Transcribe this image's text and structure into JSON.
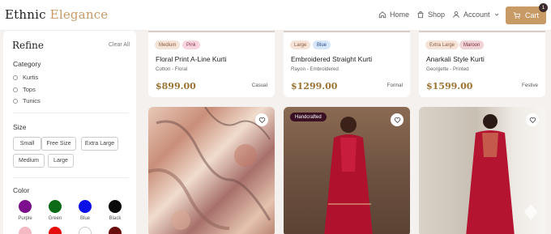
{
  "header": {
    "brand_part1": "Ethnic",
    "brand_part2": "Elegance",
    "nav_home": "Home",
    "nav_shop": "Shop",
    "nav_account": "Account",
    "cart_label": "Cart",
    "cart_count": "1",
    "accent_color": "#c89a66"
  },
  "sidebar": {
    "title": "Refine",
    "clear_all": "Clear All",
    "category_title": "Category",
    "categories": [
      "Kurtis",
      "Tops",
      "Tunics"
    ],
    "size_title": "Size",
    "sizes": [
      "Small",
      "Free Size",
      "Extra Large",
      "Medium",
      "Large"
    ],
    "color_title": "Color",
    "colors": [
      {
        "name": "Purple",
        "hex": "#7b0f8c"
      },
      {
        "name": "Green",
        "hex": "#0b6b16"
      },
      {
        "name": "Blue",
        "hex": "#0a10e6"
      },
      {
        "name": "Black",
        "hex": "#0a0a0a"
      }
    ],
    "colors_row2": [
      {
        "hex": "#f4b9c3"
      },
      {
        "hex": "#e60d0d"
      },
      {
        "hex": "#ffffff"
      },
      {
        "hex": "#6a0d0d"
      }
    ]
  },
  "products": [
    {
      "tags": [
        "Medium",
        "Pink"
      ],
      "tag_colors": [
        "#f6e3d8",
        "#f9d6df"
      ],
      "name": "Floral Print A-Line Kurti",
      "desc": "Cotton - Floral",
      "price": "$899.00",
      "occasion": "Casual"
    },
    {
      "tags": [
        "Large",
        "Blue"
      ],
      "tag_colors": [
        "#f6e3d8",
        "#d6e6fb"
      ],
      "name": "Embroidered Straight Kurti",
      "desc": "Rayon - Embroidered",
      "price": "$1299.00",
      "occasion": "Formal"
    },
    {
      "tags": [
        "Extra Large",
        "Maroon"
      ],
      "tag_colors": [
        "#f6e3d8",
        "#f0d3d7"
      ],
      "name": "Anarkali Style Kurti",
      "desc": "Georgette - Printed",
      "price": "$1599.00",
      "occasion": "Festive"
    }
  ],
  "image_cards": [
    {
      "badge": ""
    },
    {
      "badge": "Handcrafted"
    },
    {
      "badge": ""
    }
  ]
}
